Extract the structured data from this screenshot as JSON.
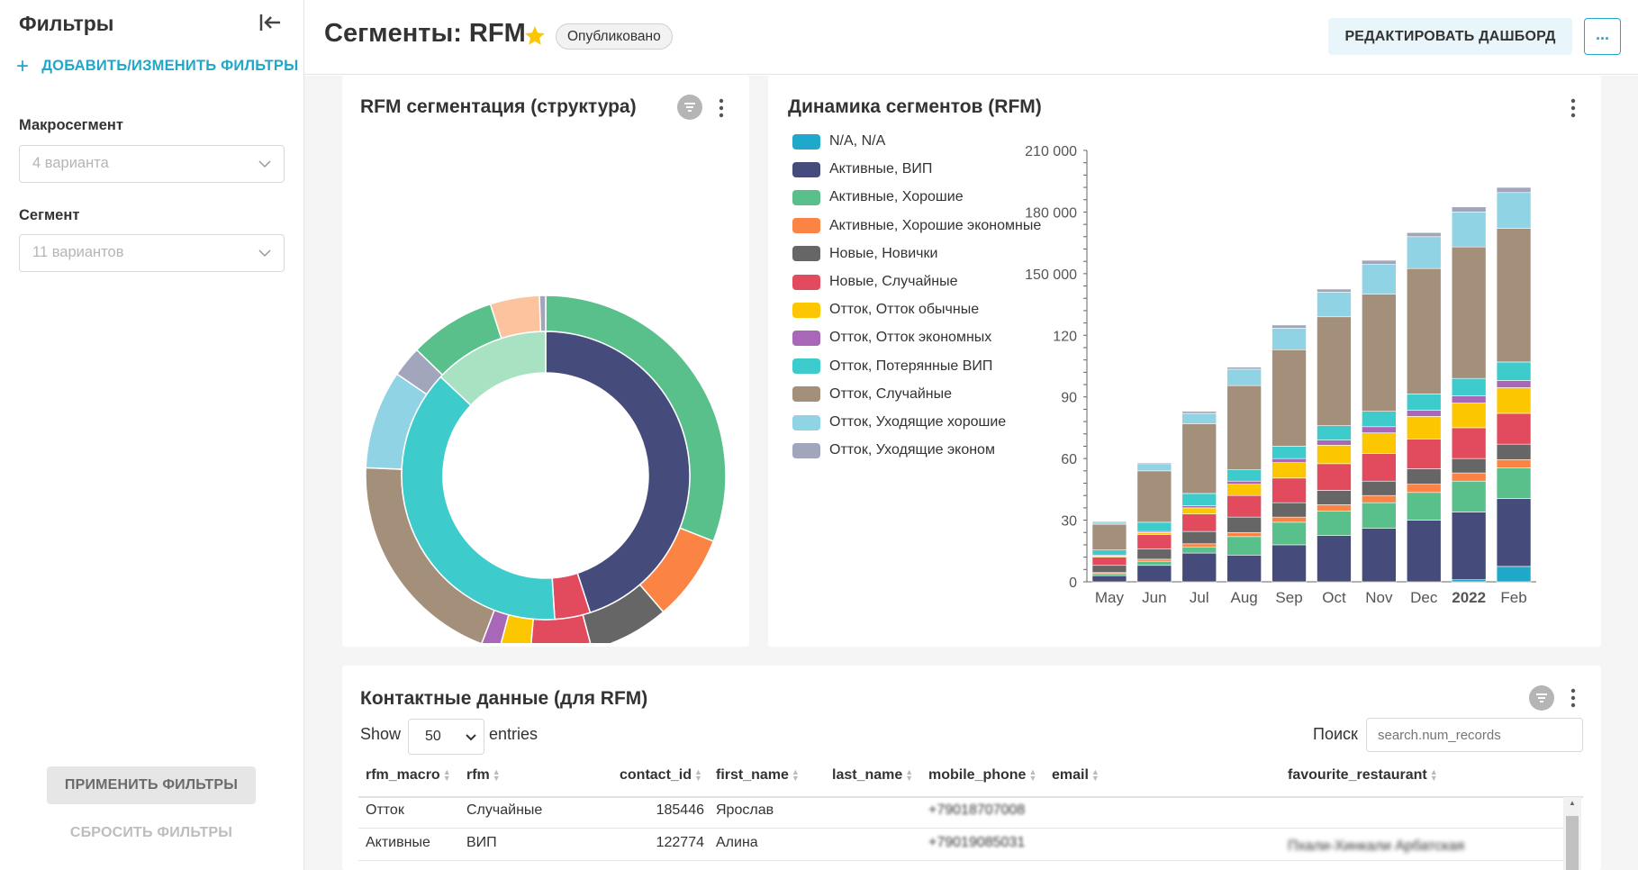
{
  "sidebar": {
    "title": "Фильтры",
    "add_filters": "ДОБАВИТЬ/ИЗМЕНИТЬ ФИЛЬТРЫ",
    "macro_label": "Макросегмент",
    "macro_placeholder": "4 варианта",
    "segment_label": "Сегмент",
    "segment_placeholder": "11 вариантов",
    "apply": "ПРИМЕНИТЬ ФИЛЬТРЫ",
    "reset": "СБРОСИТЬ ФИЛЬТРЫ"
  },
  "header": {
    "title": "Сегменты: RFM",
    "badge": "Опубликовано",
    "edit_button": "РЕДАКТИРОВАТЬ ДАШБОРД",
    "more": "..."
  },
  "charts": {
    "donut_title": "RFM сегментация (структура)",
    "bar_title": "Динамика сегментов (RFM)",
    "y_ticks": [
      "210 000",
      "180 000",
      "150 000",
      "120",
      "90",
      "60",
      "30",
      "0"
    ],
    "x_ticks": [
      "May",
      "Jun",
      "Jul",
      "Aug",
      "Sep",
      "Oct",
      "Nov",
      "Dec",
      "2022",
      "Feb"
    ]
  },
  "chart_data": [
    {
      "type": "pie",
      "title": "RFM сегментация (структура)",
      "inner_ring": [
        {
          "name": "Активные",
          "value": 45,
          "color": "#454b7b"
        },
        {
          "name": "Новые",
          "value": 4,
          "color": "#e24b5d"
        },
        {
          "name": "Отток",
          "value": 38,
          "color": "#3ecbcc"
        },
        {
          "name": "N/A",
          "value": 13,
          "color": "#a8e2c3"
        }
      ],
      "outer_ring": [
        {
          "name": "Активные, Хорошие",
          "value": 28,
          "color": "#5ac08b"
        },
        {
          "name": "Активные, Хорошие экономные",
          "value": 7,
          "color": "#fb8344"
        },
        {
          "name": "Новые, Новички",
          "value": 6.5,
          "color": "#666666"
        },
        {
          "name": "Новые, Случайные",
          "value": 5,
          "color": "#e24b5d"
        },
        {
          "name": "Отток, Отток обычные",
          "value": 2.5,
          "color": "#fcc700"
        },
        {
          "name": "Отток, Отток экономных",
          "value": 1.5,
          "color": "#a868b7"
        },
        {
          "name": "Отток, Случайные",
          "value": 18,
          "color": "#a38f7a"
        },
        {
          "name": "Отток, Уходящие хорошие",
          "value": 8,
          "color": "#8fd3e4"
        },
        {
          "name": "Отток, Уходящие эконом",
          "value": 2.5,
          "color": "#a1a6bd"
        },
        {
          "name": "Активные, Хорошие",
          "value": 7,
          "color": "#5ac08b"
        },
        {
          "name": "Отток, Уходящие хорошие (light)",
          "value": 4,
          "color": "#fcc39f"
        },
        {
          "name": "N/A, N/A",
          "value": 0.5,
          "color": "#a1a6bd"
        }
      ]
    },
    {
      "type": "bar",
      "title": "Динамика сегментов (RFM)",
      "categories": [
        "May",
        "Jun",
        "Jul",
        "Aug",
        "Sep",
        "Oct",
        "Nov",
        "Dec",
        "2022",
        "Feb"
      ],
      "ylim": [
        0,
        210000
      ],
      "series": [
        {
          "name": "N/A, N/A",
          "color": "#1fa8c9",
          "values": [
            0,
            0,
            0,
            0,
            0,
            0,
            0,
            0,
            1000,
            7500
          ]
        },
        {
          "name": "Активные, ВИП",
          "color": "#454b7b",
          "values": [
            3000,
            8000,
            14000,
            13000,
            18000,
            22500,
            26000,
            30000,
            33000,
            33000
          ]
        },
        {
          "name": "Активные, Хорошие",
          "color": "#5ac08b",
          "values": [
            1000,
            2000,
            3000,
            9000,
            11000,
            12000,
            12500,
            13500,
            15000,
            15000
          ]
        },
        {
          "name": "Активные, Хорошие экономные",
          "color": "#fb8344",
          "values": [
            500,
            1000,
            1500,
            2000,
            2500,
            3000,
            3500,
            4000,
            4000,
            4000
          ]
        },
        {
          "name": "Новые, Новички",
          "color": "#666666",
          "values": [
            3500,
            5000,
            6000,
            7500,
            7000,
            7000,
            7000,
            7500,
            7000,
            7500
          ]
        },
        {
          "name": "Новые, Случайные",
          "color": "#e24b5d",
          "values": [
            4000,
            7000,
            8500,
            10500,
            12000,
            13000,
            13500,
            14500,
            15000,
            15000
          ]
        },
        {
          "name": "Отток, Отток обычные",
          "color": "#fcc700",
          "values": [
            500,
            1000,
            3000,
            5500,
            7500,
            9000,
            10000,
            11000,
            12000,
            12500
          ]
        },
        {
          "name": "Отток, Отток экономных",
          "color": "#a868b7",
          "values": [
            500,
            500,
            1000,
            1500,
            2000,
            2500,
            3000,
            3000,
            3500,
            3500
          ]
        },
        {
          "name": "Отток, Потерянные ВИП",
          "color": "#3ecbcc",
          "values": [
            2500,
            4500,
            6000,
            5500,
            6000,
            7000,
            7500,
            8000,
            8500,
            9000
          ]
        },
        {
          "name": "Отток, Случайные",
          "color": "#a38f7a",
          "values": [
            12500,
            25000,
            34000,
            41000,
            47000,
            53000,
            57000,
            61000,
            64000,
            65000
          ]
        },
        {
          "name": "Отток, Уходящие хорошие",
          "color": "#8fd3e4",
          "values": [
            1000,
            3500,
            5000,
            8000,
            10500,
            12000,
            14500,
            15500,
            17000,
            17500
          ]
        },
        {
          "name": "Отток, Уходящие эконом",
          "color": "#a1a6bd",
          "values": [
            500,
            500,
            1000,
            1000,
            1500,
            1500,
            2000,
            2000,
            2500,
            2500
          ]
        }
      ]
    }
  ],
  "table": {
    "title": "Контактные данные (для RFM)",
    "show_label": "Show",
    "page_size": "50",
    "entries_label": "entries",
    "search_label": "Поиск",
    "search_placeholder": "search.num_records",
    "columns": [
      "rfm_macro",
      "rfm",
      "contact_id",
      "first_name",
      "last_name",
      "mobile_phone",
      "email",
      "favourite_restaurant"
    ],
    "rows": [
      {
        "rfm_macro": "Отток",
        "rfm": "Случайные",
        "contact_id": "185446",
        "first_name": "Ярослав",
        "mobile_phone": "+79018707008"
      },
      {
        "rfm_macro": "Активные",
        "rfm": "ВИП",
        "contact_id": "122774",
        "first_name": "Алина",
        "mobile_phone": "+79019085031",
        "favourite_restaurant": "Пхали-Хинкали Арбатская"
      }
    ]
  }
}
